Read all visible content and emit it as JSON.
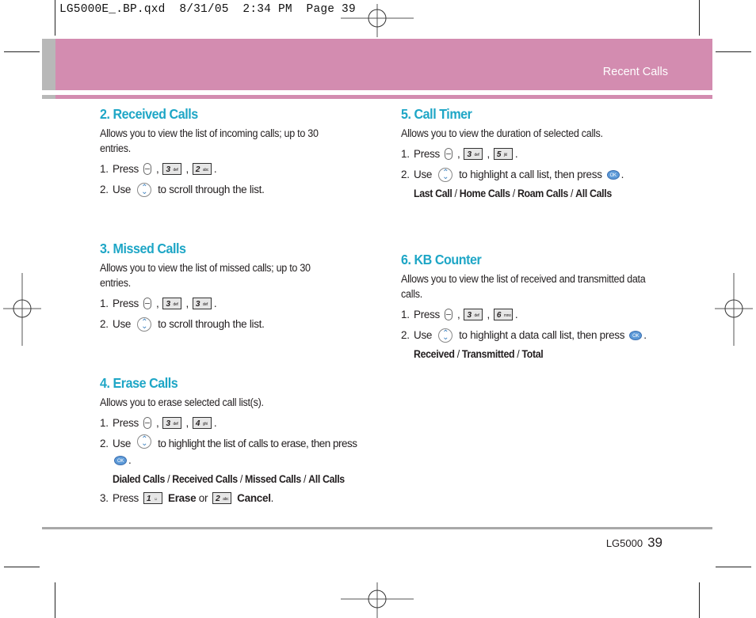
{
  "print_slug": "LG5000E_.BP.qxd  8/31/05  2:34 PM  Page 39",
  "header": {
    "section_label": "Recent Calls"
  },
  "footer": {
    "model": "LG5000",
    "page_number": "39"
  },
  "key_labels": {
    "k1": {
      "digit": "1",
      "letters": "☺"
    },
    "k2": {
      "digit": "2",
      "letters": "abc"
    },
    "k3": {
      "digit": "3",
      "letters": "def"
    },
    "k4": {
      "digit": "4",
      "letters": "ghi"
    },
    "k5": {
      "digit": "5",
      "letters": "jkl"
    },
    "k6": {
      "digit": "6",
      "letters": "mno"
    },
    "ok": "OK"
  },
  "sections": {
    "received": {
      "title": "2. Received Calls",
      "desc": "Allows you to view the list of incoming calls; up to 30 entries.",
      "step1_num": "1.",
      "step1_text": "Press",
      "step2_num": "2.",
      "step2_pre": "Use",
      "step2_post": "to scroll through the list."
    },
    "missed": {
      "title": "3. Missed Calls",
      "desc": "Allows you to view the list of missed calls; up to 30 entries.",
      "step1_num": "1.",
      "step1_text": "Press",
      "step2_num": "2.",
      "step2_pre": "Use",
      "step2_post": "to scroll through the list."
    },
    "erase": {
      "title": "4. Erase Calls",
      "desc": "Allows you to erase selected call list(s).",
      "step1_num": "1.",
      "step1_text": "Press",
      "step2_num": "2.",
      "step2_pre": "Use",
      "step2_post": "to highlight the list of calls to erase, then press",
      "options": [
        "Dialed Calls",
        "Received Calls",
        "Missed Calls",
        "All Calls"
      ],
      "step3_num": "3.",
      "step3_pre": "Press",
      "step3_erase": "Erase",
      "step3_or": "or",
      "step3_cancel": "Cancel"
    },
    "timer": {
      "title": "5. Call Timer",
      "desc": "Allows you to view the duration of selected calls.",
      "step1_num": "1.",
      "step1_text": "Press",
      "step2_num": "2.",
      "step2_pre": "Use",
      "step2_post": "to highlight a call list, then press",
      "options": [
        "Last Call",
        "Home Calls",
        "Roam Calls",
        "All Calls"
      ]
    },
    "kb": {
      "title": "6. KB Counter",
      "desc": "Allows you to view the list of received and transmitted data calls.",
      "step1_num": "1.",
      "step1_text": "Press",
      "step2_num": "2.",
      "step2_pre": "Use",
      "step2_post": "to highlight a data call list, then press",
      "options": [
        "Received",
        "Transmitted",
        "Total"
      ]
    }
  }
}
